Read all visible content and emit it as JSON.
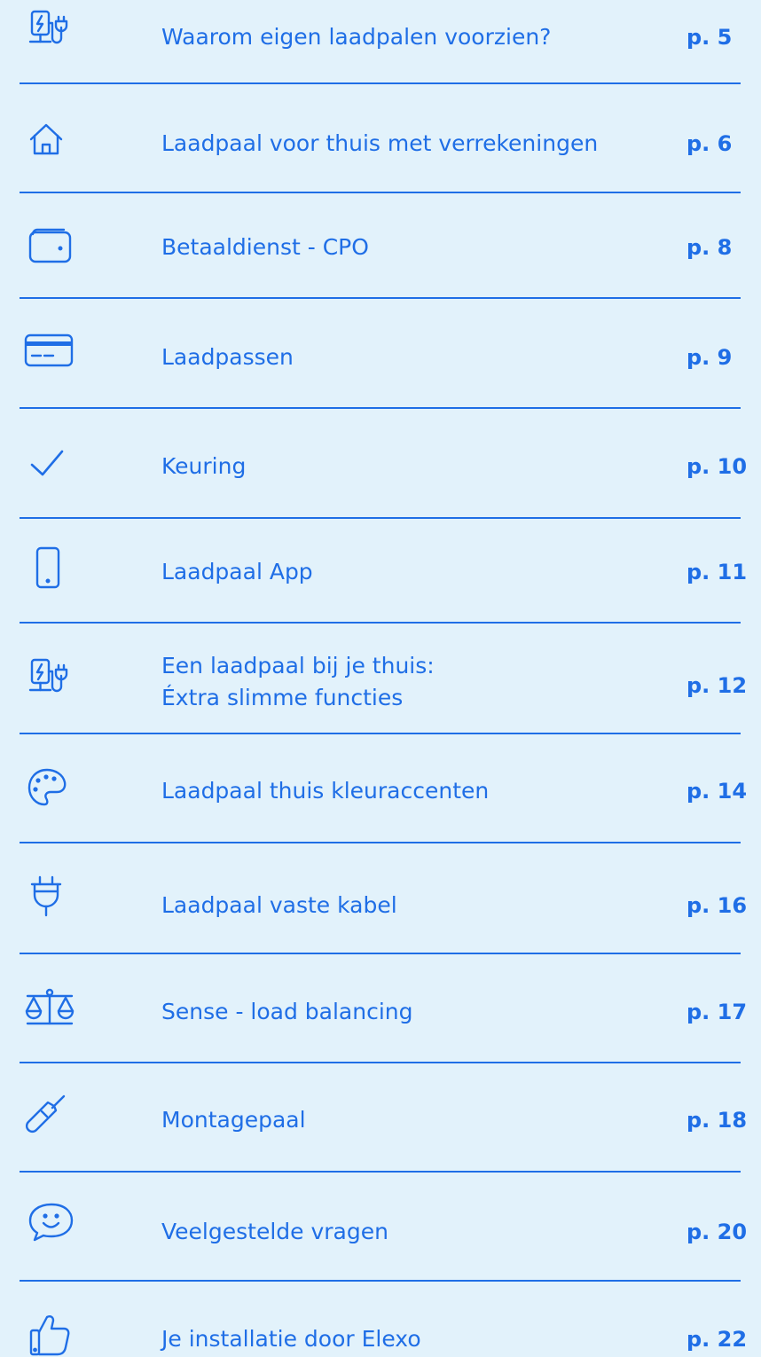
{
  "colors": {
    "accent": "#1f6ee6",
    "background": "#e2f2fb"
  },
  "entries": [
    {
      "icon": "ev-charger-icon",
      "title": "Waarom eigen laadpalen voorzien?",
      "page": "p. 5"
    },
    {
      "icon": "home-icon",
      "title": "Laadpaal voor thuis met verrekeningen",
      "page": "p. 6"
    },
    {
      "icon": "wallet-icon",
      "title": "Betaaldienst - CPO",
      "page": "p. 8"
    },
    {
      "icon": "credit-card-icon",
      "title": "Laadpassen",
      "page": "p. 9"
    },
    {
      "icon": "checkmark-icon",
      "title": "Keuring",
      "page": "p. 10"
    },
    {
      "icon": "smartphone-icon",
      "title": "Laadpaal App",
      "page": "p. 11"
    },
    {
      "icon": "ev-charger-icon",
      "title_line1": "Een laadpaal bij je thuis:",
      "title_line2": "Éxtra slimme functies",
      "page": "p. 12"
    },
    {
      "icon": "palette-icon",
      "title": "Laadpaal thuis kleuraccenten",
      "page": "p. 14"
    },
    {
      "icon": "plug-icon",
      "title": "Laadpaal vaste kabel",
      "page": "p. 16"
    },
    {
      "icon": "scales-icon",
      "title": "Sense - load balancing",
      "page": "p. 17"
    },
    {
      "icon": "screwdriver-icon",
      "title": "Montagepaal",
      "page": "p. 18"
    },
    {
      "icon": "chat-smiley-icon",
      "title": "Veelgestelde vragen",
      "page": "p. 20"
    },
    {
      "icon": "thumbs-up-icon",
      "title": "Je installatie door Elexo",
      "page": "p. 22"
    }
  ]
}
